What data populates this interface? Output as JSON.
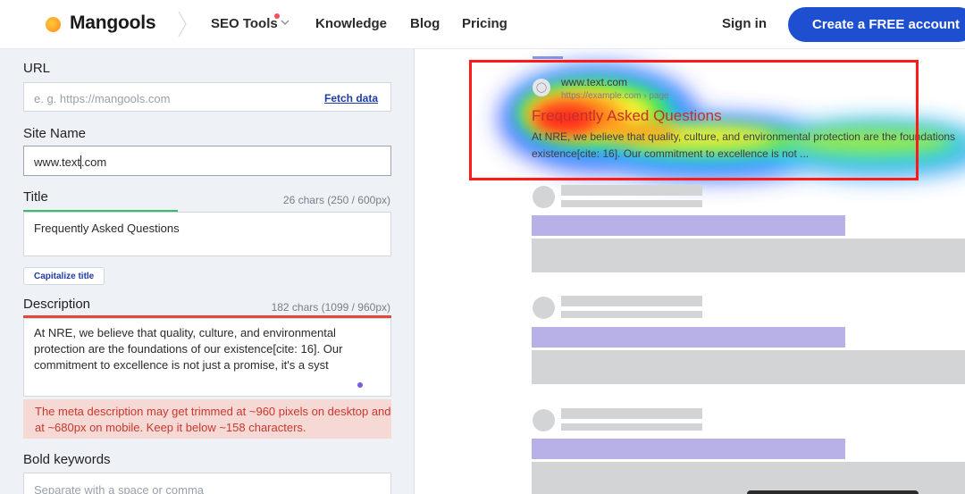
{
  "header": {
    "logo_text": "Mangools",
    "nav": {
      "seo_tools": "SEO Tools",
      "knowledge": "Knowledge",
      "blog": "Blog",
      "pricing": "Pricing"
    },
    "sign_in": "Sign in",
    "cta": "Create a FREE account"
  },
  "form": {
    "url": {
      "label": "URL",
      "placeholder": "e. g. https://mangools.com",
      "fetch": "Fetch data"
    },
    "site_name": {
      "label": "Site Name",
      "value_before_cursor": "www.text",
      "value_after_cursor": ".com"
    },
    "title": {
      "label": "Title",
      "count": "26 chars (250 / 600px)",
      "value": "Frequently Asked Questions",
      "length_fraction": 0.42,
      "capitalize_button": "Capitalize title"
    },
    "description": {
      "label": "Description",
      "count": "182 chars (1099 / 960px)",
      "value": "At NRE, we believe that quality, culture, and environmental protection are the foundations of our existence[cite: 16]. Our commitment to excellence is not just a promise, it's a syst",
      "warning": "The meta description may get trimmed at ~960 pixels on desktop and at ~680px on mobile. Keep it below ~158 characters."
    },
    "bold_keywords": {
      "label": "Bold keywords",
      "placeholder": "Separate with a space or comma"
    }
  },
  "preview": {
    "url": "www.text.com",
    "breadcrumb": "https://example.com › page",
    "title": "Frequently Asked Questions",
    "description_line1": "At NRE, we believe that quality, culture, and environmental protection are the foundations",
    "description_line2": "existence[cite: 16]. Our commitment to excellence is not ..."
  },
  "colors": {
    "brand_blue": "#1e4fd0",
    "highlight_red": "#ff1a1a",
    "skeleton_purple": "#b7b1e7",
    "warning_bg": "#f6d8d5",
    "warning_text": "#c8392c"
  }
}
